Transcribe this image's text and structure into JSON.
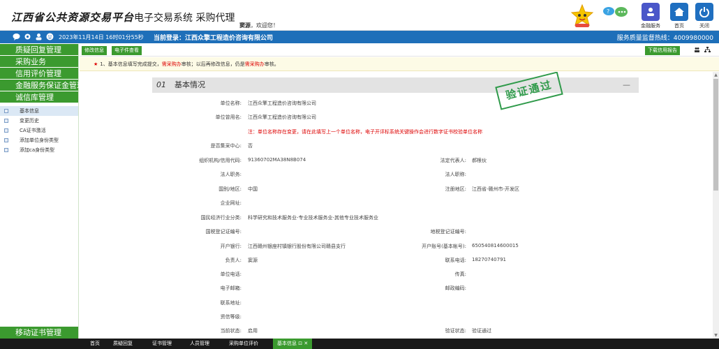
{
  "header": {
    "brand_bold": "江西省公共资源交易平台",
    "brand_sub": "电子交易系统  采购代理",
    "welcome_name": "窦源",
    "welcome_suffix": "，欢迎您！",
    "buttons": [
      {
        "label": "金融服务",
        "color": "#4a57c9"
      },
      {
        "label": "首页",
        "color": "#1f6fc0"
      },
      {
        "label": "关闭",
        "color": "#1f6fc0"
      }
    ]
  },
  "bluebar": {
    "datetime": "2023年11月14日 16时01分55秒",
    "login": "当前登录：江西众擎工程造价咨询有限公司",
    "hotline": "服务质量监督热线：4009980000"
  },
  "sidebar": {
    "menus": [
      "质疑回复管理",
      "采购业务",
      "信用评价管理",
      "金融服务保证金管理",
      "诚信库管理"
    ],
    "sub_items": [
      "基本信息",
      "变更历史",
      "CA证书激活",
      "添加单位身份类型",
      "添加ca身份类型"
    ],
    "bottom": "移动证书管理"
  },
  "toolbar": {
    "edit": "修改信息",
    "files": "电子件查看",
    "download": "下载信用报告"
  },
  "notice": {
    "star": "★",
    "p1": "1、基本信息填写完成提交，",
    "r1": "需采购办",
    "p2": "审核；以后再修改信息，仍是",
    "r2": "需采购办",
    "p3": "审核。"
  },
  "section": {
    "num": "01",
    "title": "基本情况",
    "collapse": "—",
    "stamp": "验证通过"
  },
  "form": {
    "unit_name_label": "单位名称:",
    "unit_name": "江西众擎工程造价咨询有限公司",
    "former_name_label": "单位曾用名:",
    "former_name": "江西众擎工程造价咨询有限公司",
    "note": "注：单位名称存在变更，请在此填写上一个单位名称，电子开评标系统关键操作会进行数字证书校验单位名称",
    "central_label": "是否集采中心:",
    "central": "否",
    "code_label": "组织机构/信用代码:",
    "code": "91360702MA38N8B074",
    "legal_rep_label": "法定代表人:",
    "legal_rep": "郝根伙",
    "legal_duty_label": "法人职务:",
    "legal_title_label": "法人职称:",
    "country_label": "国别/地区:",
    "country": "中国",
    "reg_area_label": "注册地区:",
    "reg_area": "江西省-赣州市-开发区",
    "website_label": "企业网址:",
    "industry_label": "国民经济行业分类:",
    "industry": "科学研究和技术服务业-专业技术服务业-其他专业技术服务业",
    "natl_tax_label": "国税登记证编号:",
    "local_tax_label": "地税登记证编号:",
    "bank_label": "开户银行:",
    "bank": "江西赣州银座村镇银行股份有限公司赣县支行",
    "account_label": "开户账号(基本帐号):",
    "account": "650540814600015",
    "principal_label": "负责人:",
    "principal": "窦源",
    "contact_phone_label": "联系电话:",
    "contact_phone": "18270740791",
    "unit_phone_label": "单位电话:",
    "fax_label": "传真:",
    "email_label": "电子邮箱:",
    "postcode_label": "邮政编码:",
    "address_label": "联系地址:",
    "credit_label": "资信等级:",
    "status_label": "当前状态:",
    "status": "启用",
    "verify_label": "验证状态:",
    "verify": "验证通过"
  },
  "bottombar": {
    "tabs": [
      "首页",
      "质疑回复",
      "证书管理",
      "人员管理",
      "采购单位评价"
    ],
    "active": "基本信息 ⊡ ✕"
  }
}
